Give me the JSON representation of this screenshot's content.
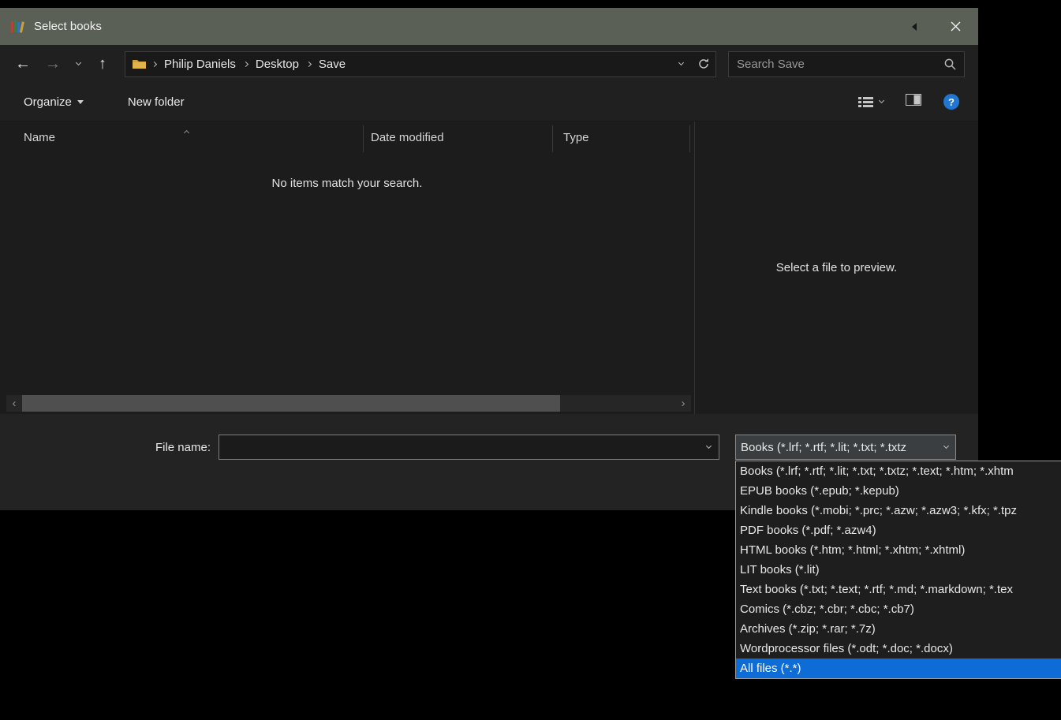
{
  "titlebar": {
    "title": "Select books"
  },
  "nav": {
    "breadcrumb": {
      "items": [
        "Philip Daniels",
        "Desktop",
        "Save"
      ]
    },
    "search": {
      "placeholder": "Search Save"
    }
  },
  "toolbar": {
    "organize_label": "Organize",
    "new_folder_label": "New folder",
    "help_glyph": "?"
  },
  "icons": {
    "back": "←",
    "forward": "→",
    "up": "↑",
    "scroll_left": "‹",
    "scroll_right": "›"
  },
  "list": {
    "columns": {
      "name": "Name",
      "date_modified": "Date modified",
      "type": "Type"
    },
    "empty_message": "No items match your search."
  },
  "preview": {
    "message": "Select a file to preview."
  },
  "footer": {
    "file_name_label": "File name:",
    "file_name_value": "",
    "file_type_value": "Books (*.lrf; *.rtf; *.lit; *.txt; *.txtz"
  },
  "file_type_dropdown": {
    "items": [
      "Books (*.lrf; *.rtf; *.lit; *.txt; *.txtz; *.text; *.htm; *.xhtm",
      "EPUB books (*.epub; *.kepub)",
      "Kindle books (*.mobi; *.prc; *.azw; *.azw3; *.kfx; *.tpz",
      "PDF books (*.pdf; *.azw4)",
      "HTML books (*.htm; *.html; *.xhtm; *.xhtml)",
      "LIT books (*.lit)",
      "Text books (*.txt; *.text; *.rtf; *.md; *.markdown; *.tex",
      "Comics (*.cbz; *.cbr; *.cbc; *.cb7)",
      "Archives (*.zip; *.rar; *.7z)",
      "Wordprocessor files (*.odt; *.doc; *.docx)",
      "All files (*.*)"
    ],
    "selected": "All files (*.*)"
  },
  "colors": {
    "titlebar": "#5a6056",
    "selection": "#0e6cd6",
    "help_accent": "#2176d2"
  }
}
